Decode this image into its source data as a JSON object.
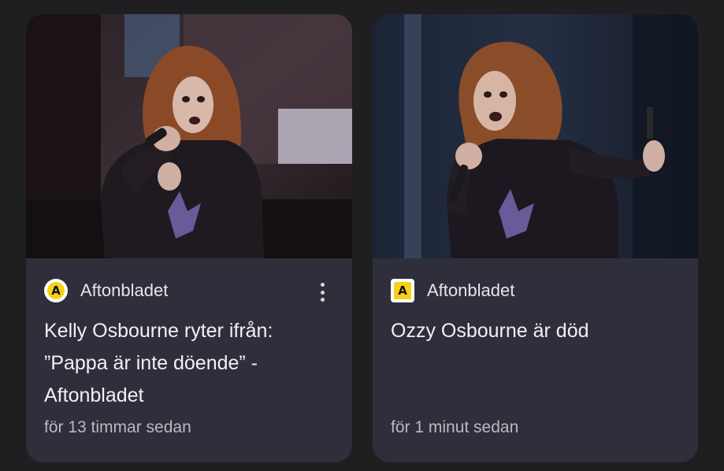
{
  "feed": {
    "cards": [
      {
        "source": "Aftonbladet",
        "source_icon": "aftonbladet-logo-icon",
        "headline": "Kelly Osbourne ryter ifrån: ”Pappa är inte döende” - Aftonbladet",
        "timestamp": "för 13 timmar sedan",
        "menu_icon": "more-vert-icon"
      },
      {
        "source": "Aftonbladet",
        "source_icon": "aftonbladet-logo-icon",
        "headline": "Ozzy Osbourne är död",
        "timestamp": "för 1 minut sedan"
      }
    ],
    "logo_letter": "A",
    "colors": {
      "background": "#1f1f21",
      "card": "#2e2f3a",
      "logo_yellow": "#f7d117",
      "text_primary": "#f1f1f4",
      "text_secondary": "#b8b9c2"
    }
  }
}
